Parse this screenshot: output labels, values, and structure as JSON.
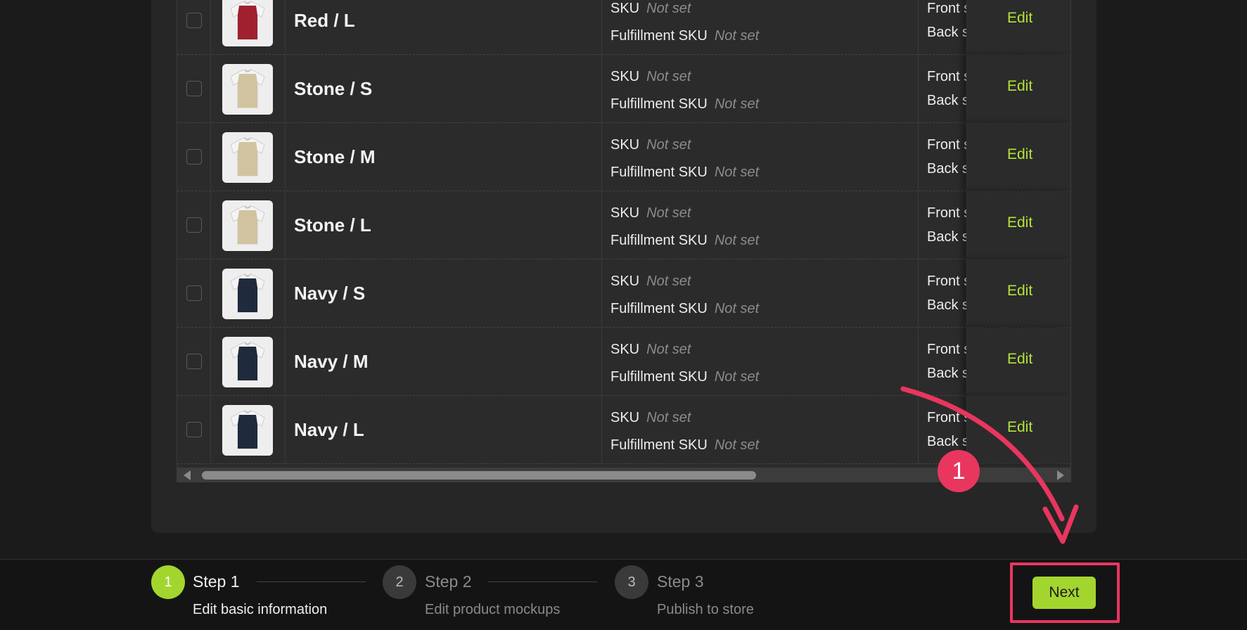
{
  "variants": [
    {
      "name": "Red / L",
      "color": "#a0202f",
      "sku_label": "SKU",
      "sku_value": "Not set",
      "fsku_label": "Fulfillment SKU",
      "fsku_value": "Not set",
      "print_front": "Front side",
      "print_back": "Back side",
      "edit_label": "Edit"
    },
    {
      "name": "Stone / S",
      "color": "#d2c3a0",
      "sku_label": "SKU",
      "sku_value": "Not set",
      "fsku_label": "Fulfillment SKU",
      "fsku_value": "Not set",
      "print_front": "Front side",
      "print_back": "Back side",
      "edit_label": "Edit"
    },
    {
      "name": "Stone / M",
      "color": "#d2c3a0",
      "sku_label": "SKU",
      "sku_value": "Not set",
      "fsku_label": "Fulfillment SKU",
      "fsku_value": "Not set",
      "print_front": "Front side",
      "print_back": "Back side",
      "edit_label": "Edit"
    },
    {
      "name": "Stone / L",
      "color": "#d2c3a0",
      "sku_label": "SKU",
      "sku_value": "Not set",
      "fsku_label": "Fulfillment SKU",
      "fsku_value": "Not set",
      "print_front": "Front side",
      "print_back": "Back side",
      "edit_label": "Edit"
    },
    {
      "name": "Navy / S",
      "color": "#1f2a3c",
      "sku_label": "SKU",
      "sku_value": "Not set",
      "fsku_label": "Fulfillment SKU",
      "fsku_value": "Not set",
      "print_front": "Front side",
      "print_back": "Back side",
      "edit_label": "Edit"
    },
    {
      "name": "Navy / M",
      "color": "#1f2a3c",
      "sku_label": "SKU",
      "sku_value": "Not set",
      "fsku_label": "Fulfillment SKU",
      "fsku_value": "Not set",
      "print_front": "Front side",
      "print_back": "Back side",
      "edit_label": "Edit"
    },
    {
      "name": "Navy / L",
      "color": "#1f2a3c",
      "sku_label": "SKU",
      "sku_value": "Not set",
      "fsku_label": "Fulfillment SKU",
      "fsku_value": "Not set",
      "print_front": "Front side",
      "print_back": "Back side",
      "edit_label": "Edit"
    }
  ],
  "steps": [
    {
      "number": "1",
      "title": "Step 1",
      "description": "Edit basic information",
      "active": true
    },
    {
      "number": "2",
      "title": "Step 2",
      "description": "Edit product mockups",
      "active": false
    },
    {
      "number": "3",
      "title": "Step 3",
      "description": "Publish to store",
      "active": false
    }
  ],
  "footer": {
    "next_label": "Next"
  },
  "annotation": {
    "badge_number": "1",
    "color": "#e8365f"
  },
  "colors": {
    "accent": "#a3d52f",
    "edit_link": "#b4e33a",
    "annotation": "#e8365f"
  }
}
